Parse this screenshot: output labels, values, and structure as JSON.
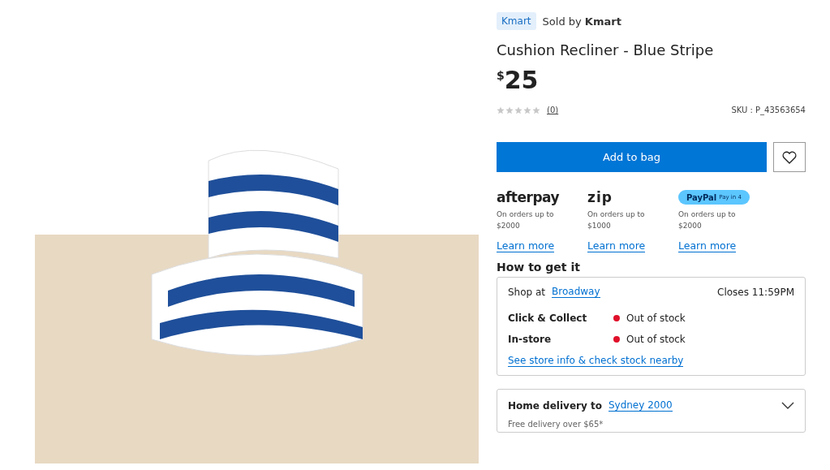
{
  "product": {
    "brand_tag": "Kmart",
    "sold_by_prefix": "Sold by",
    "seller": "Kmart",
    "title": "Cushion Recliner - Blue Stripe",
    "currency": "$",
    "price": "25",
    "stars": 0,
    "review_count": "(0)",
    "sku": "SKU : P_43563654"
  },
  "actions": {
    "add_to_bag": "Add to bag",
    "wishlisted": false
  },
  "payments": [
    {
      "kind": "afterpay",
      "logo": "afterpay",
      "note": "On orders up to $2000",
      "link": "Learn more"
    },
    {
      "kind": "zip",
      "logo": "zip",
      "note": "On orders up to $1000",
      "link": "Learn more"
    },
    {
      "kind": "paypal",
      "logo": "PayPal",
      "logo_suffix": "Pay in 4",
      "note": "On orders up to $2000",
      "link": "Learn more"
    }
  ],
  "how_to_get_it": {
    "heading": "How to get it",
    "shop_at": "Shop at",
    "store": "Broadway",
    "closes": "Closes 11:59PM",
    "options": [
      {
        "name": "Click & Collect",
        "status": "Out of stock",
        "color": "#e0102a"
      },
      {
        "name": "In-store",
        "status": "Out of stock",
        "color": "#e0102a"
      }
    ],
    "store_link": "See store info & check stock nearby"
  },
  "delivery": {
    "label": "Home delivery to",
    "location": "Sydney 2000",
    "expanded": false,
    "note": "Free delivery over $65*"
  }
}
